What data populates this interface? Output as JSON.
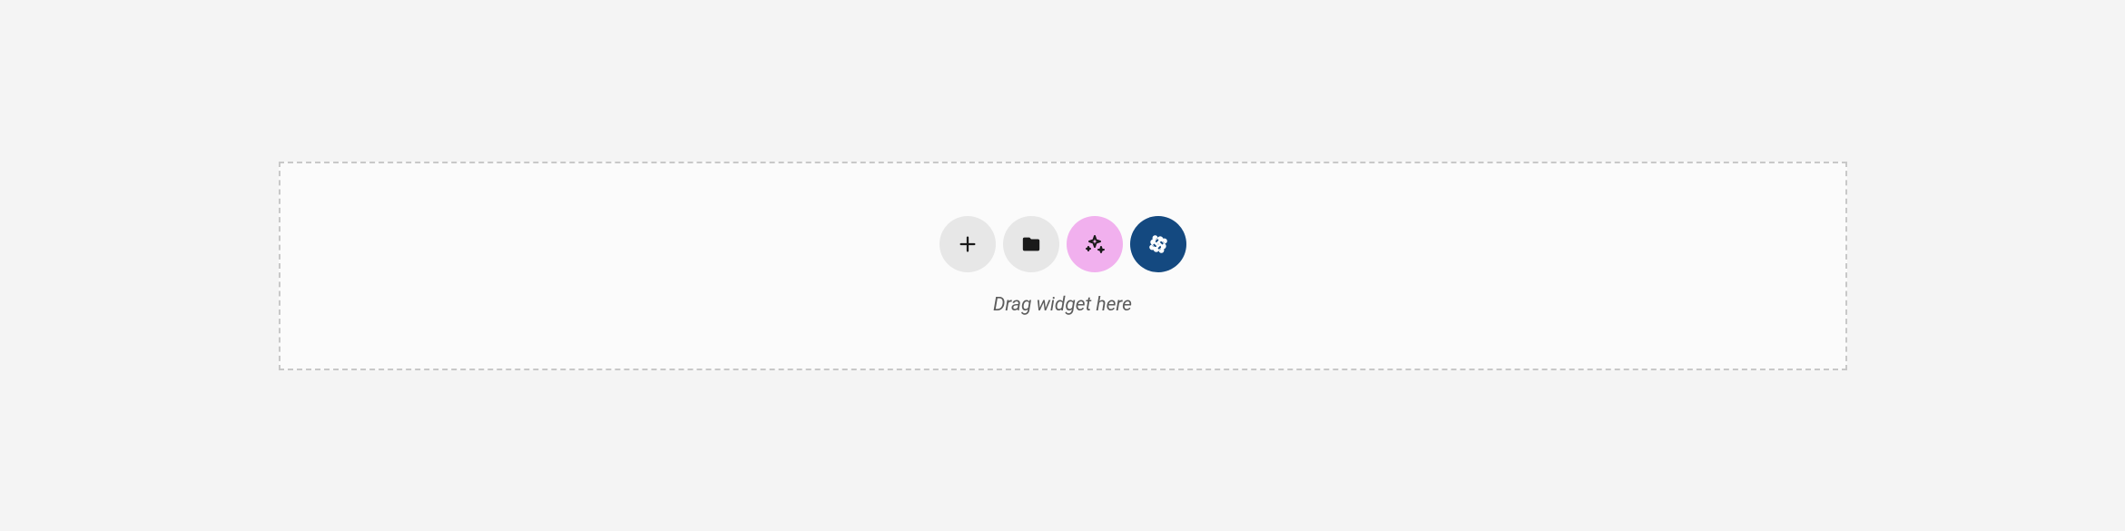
{
  "dropzone": {
    "hint": "Drag widget here"
  },
  "buttons": {
    "add": {
      "name": "plus-icon"
    },
    "folder": {
      "name": "folder-icon"
    },
    "sparkle": {
      "name": "sparkle-icon"
    },
    "joomla": {
      "name": "joomla-icon"
    }
  }
}
